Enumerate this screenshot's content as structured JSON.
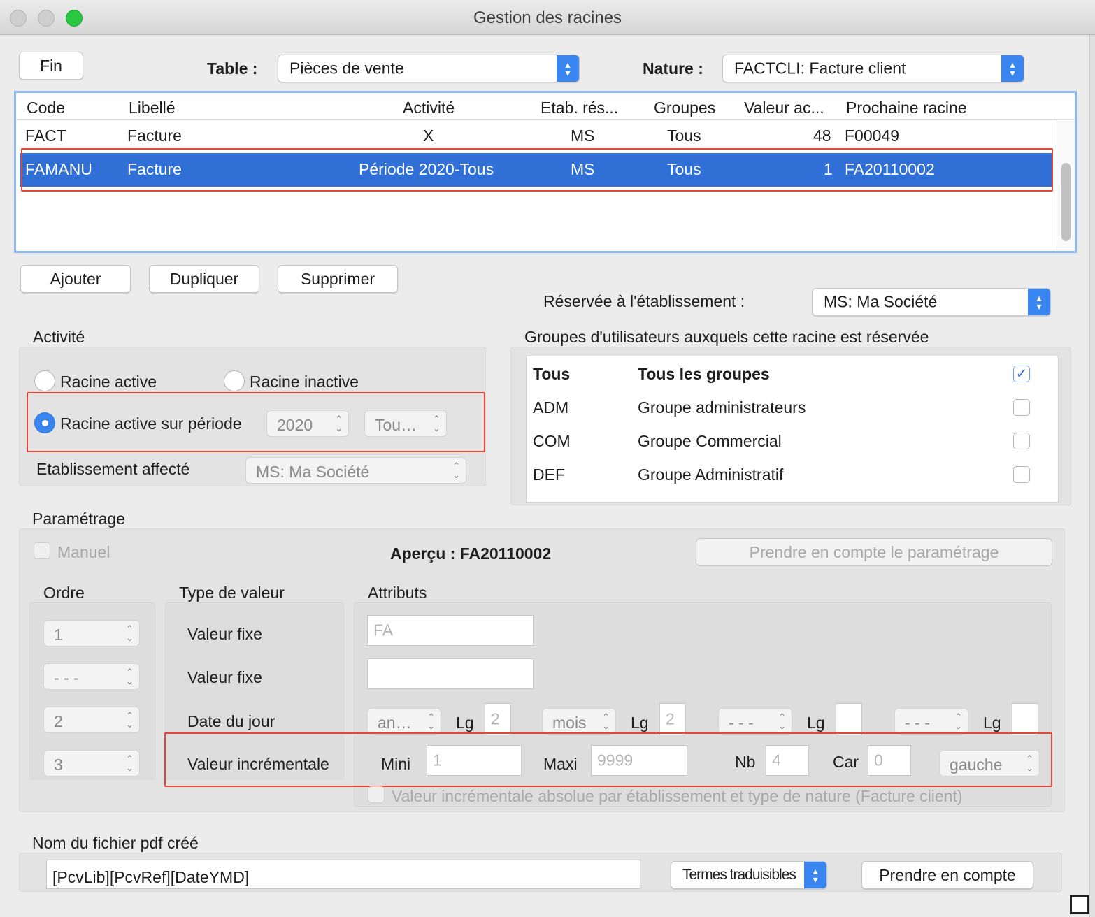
{
  "window": {
    "title": "Gestion des racines",
    "traffic_lights": [
      "#ff5f57",
      "#c8c8c8",
      "#28c840"
    ]
  },
  "toolbar": {
    "fin_label": "Fin",
    "table_label": "Table :",
    "table_value": "Pièces de vente",
    "nature_label": "Nature :",
    "nature_value": "FACTCLI: Facture client"
  },
  "grid": {
    "columns": [
      "Code",
      "Libellé",
      "Activité",
      "Etab. rés...",
      "Groupes",
      "Valeur ac...",
      "Prochaine racine"
    ],
    "rows": [
      {
        "code": "FACT",
        "libelle": "Facture",
        "activite": "X",
        "etab": "MS",
        "groupes": "Tous",
        "valeur": "48",
        "prochaine": "F00049",
        "selected": false
      },
      {
        "code": "FAMANU",
        "libelle": "Facture",
        "activite": "Période 2020-Tous",
        "etab": "MS",
        "groupes": "Tous",
        "valeur": "1",
        "prochaine": "FA20110002",
        "selected": true
      }
    ]
  },
  "actions": {
    "ajouter": "Ajouter",
    "dupliquer": "Dupliquer",
    "supprimer": "Supprimer"
  },
  "reserve": {
    "label": "Réservée à l'établissement :",
    "value": "MS: Ma Société"
  },
  "activite": {
    "title": "Activité",
    "radio_active": "Racine active",
    "radio_inactive": "Racine inactive",
    "radio_periode": "Racine active sur période",
    "periode_annee": "2020",
    "periode_mois": "Tou…",
    "etab_label": "Etablissement affecté",
    "etab_value": "MS: Ma Société"
  },
  "groupes": {
    "title": "Groupes d'utilisateurs auxquels cette racine est réservée",
    "items": [
      {
        "code": "Tous",
        "label": "Tous les groupes",
        "checked": true
      },
      {
        "code": "ADM",
        "label": "Groupe administrateurs",
        "checked": false
      },
      {
        "code": "COM",
        "label": "Groupe Commercial",
        "checked": false
      },
      {
        "code": "DEF",
        "label": "Groupe Administratif",
        "checked": false
      }
    ]
  },
  "parametrage": {
    "title": "Paramétrage",
    "manuel_label": "Manuel",
    "apercu": "Aperçu : FA20110002",
    "prendre_btn": "Prendre en compte le paramétrage",
    "ordre_title": "Ordre",
    "type_title": "Type de valeur",
    "attributs_title": "Attributs",
    "ordres": [
      "1",
      "- - -",
      "2",
      "3"
    ],
    "types": [
      "Valeur fixe",
      "Valeur fixe",
      "Date du jour",
      "Valeur incrémentale"
    ],
    "attr_fixe1": "FA",
    "attr_fixe2": "",
    "date": {
      "p1": "an…",
      "lg1": "2",
      "p2": "mois",
      "lg2": "2",
      "p3": "- - -",
      "lg3": "",
      "p4": "- - -",
      "lg4": "",
      "lg_label": "Lg"
    },
    "incr": {
      "mini_label": "Mini",
      "mini": "1",
      "maxi_label": "Maxi",
      "maxi": "9999",
      "nb_label": "Nb",
      "nb": "4",
      "car_label": "Car",
      "car": "0",
      "align": "gauche"
    },
    "absolue_label": "Valeur incrémentale absolue par établissement et type de nature (Facture client)"
  },
  "pdf": {
    "title": "Nom du fichier pdf créé",
    "value": "[PcvLib][PcvRef][DateYMD]",
    "termes": "Termes traduisibles",
    "prendre": "Prendre en compte"
  }
}
